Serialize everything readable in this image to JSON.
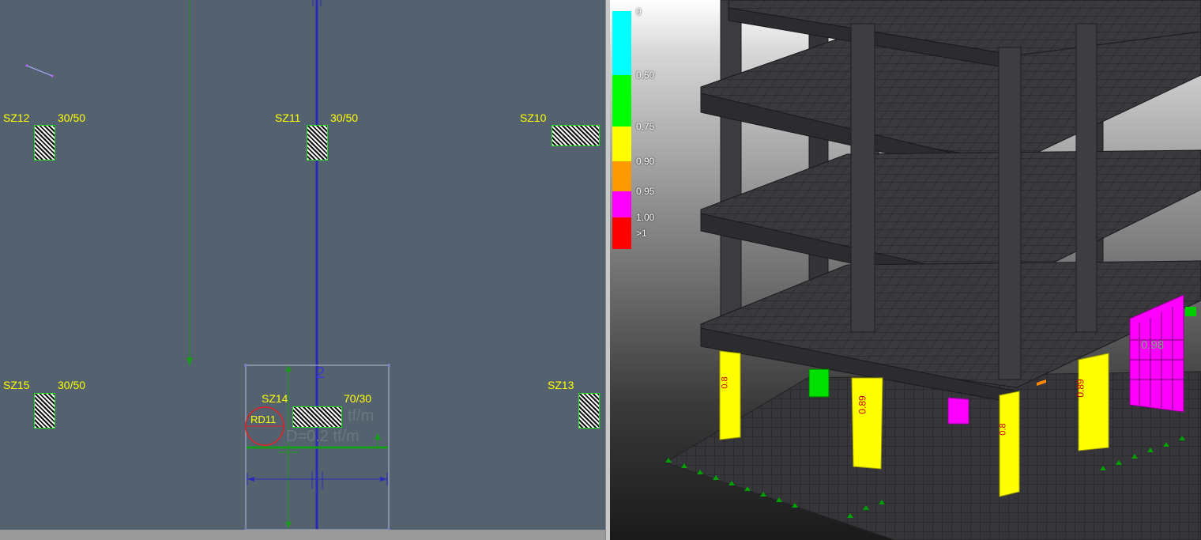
{
  "plan": {
    "axis_label": "2",
    "columns": [
      {
        "name": "SZ12",
        "size": "30/50"
      },
      {
        "name": "SZ11",
        "size": "30/50"
      },
      {
        "name": "SZ10",
        "size": ""
      },
      {
        "name": "SZ15",
        "size": "30/50"
      },
      {
        "name": "SZ14",
        "size": "70/30"
      },
      {
        "name": "SZ13",
        "size": ""
      }
    ],
    "wall_label": "RD11",
    "load_text_1": "tf/m",
    "load_text_2": "D=0.2 tf/m"
  },
  "legend": {
    "colors": [
      "#00ffff",
      "#00ff00",
      "#ffff00",
      "#ff9900",
      "#ff00ff",
      "#ff0000"
    ],
    "values": [
      "0",
      "0.50",
      "0.75",
      "0.90",
      "0.95",
      "1.00",
      ">1"
    ]
  },
  "model": {
    "labels": [
      "0.8",
      "0.89",
      "0.8",
      "0.89",
      "0.98"
    ]
  }
}
